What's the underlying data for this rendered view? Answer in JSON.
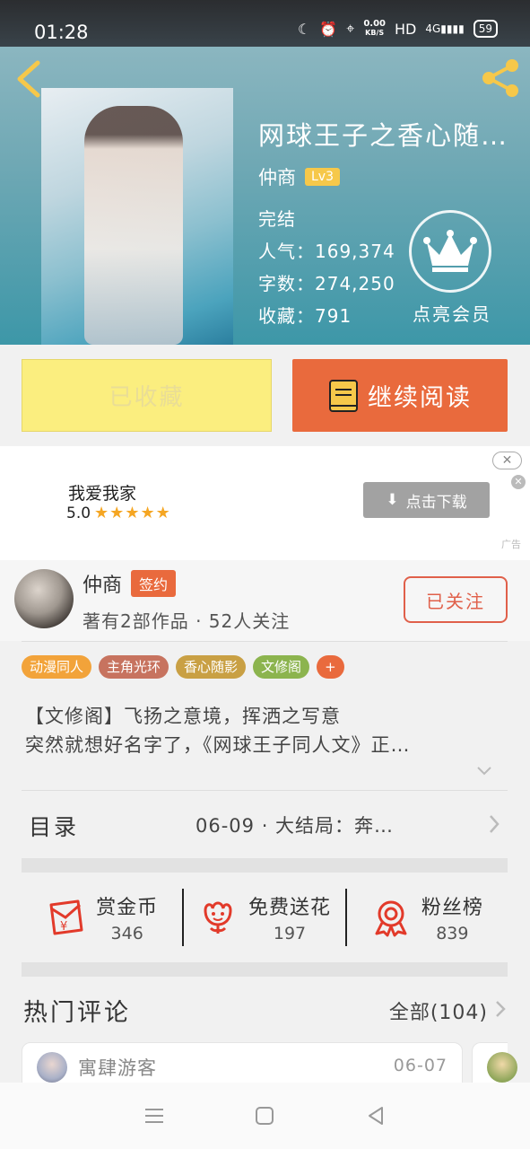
{
  "status_bar": {
    "time": "01:28",
    "net_speed_value": "0.00",
    "net_speed_unit": "KB/S",
    "hd": "HD",
    "signal": "4G",
    "battery": "59"
  },
  "book": {
    "title": "网球王子之香心随…",
    "author": "仲商",
    "level": "Lv3",
    "status": "完结",
    "popularity": "人气：169,374",
    "word_count": "字数：274,250",
    "collections": "收藏：791",
    "vip_label": "点亮会员"
  },
  "actions": {
    "collected": "已收藏",
    "continue_reading": "继续阅读"
  },
  "ad": {
    "title": "我爱我家",
    "rating": "5.0",
    "stars": "★★★★★",
    "download": "点击下载",
    "close": "✕",
    "x": "✕",
    "source": "广告"
  },
  "author_card": {
    "name": "仲商",
    "badge": "签约",
    "subtitle": "著有2部作品 · 52人关注",
    "follow": "已关注"
  },
  "tags": [
    {
      "label": "动漫同人",
      "color": "#f2a33a"
    },
    {
      "label": "主角光环",
      "color": "#c7735f"
    },
    {
      "label": "香心随影",
      "color": "#c9a044"
    },
    {
      "label": "文修阁",
      "color": "#8cb44e"
    },
    {
      "label": "+",
      "color": "#e96a3d"
    }
  ],
  "intro": {
    "line1": "【文修阁】飞扬之意境，挥洒之写意",
    "line2": "突然就想好名字了，《网球王子同人文》正…"
  },
  "catalog": {
    "label": "目录",
    "latest": "06-09 · 大结局：奔…"
  },
  "stats": [
    {
      "label": "赏金币",
      "value": "346",
      "icon": "red-envelope-icon"
    },
    {
      "label": "免费送花",
      "value": "197",
      "icon": "flower-icon"
    },
    {
      "label": "粉丝榜",
      "value": "839",
      "icon": "medal-icon"
    }
  ],
  "comments": {
    "label": "热门评论",
    "all": "全部(104)",
    "first_user": "寓肆游客",
    "first_date": "06-07"
  },
  "colors": {
    "accent": "#e96a3d",
    "collected_bg": "#fbee7f",
    "header_bg": "#5aa5b4"
  }
}
